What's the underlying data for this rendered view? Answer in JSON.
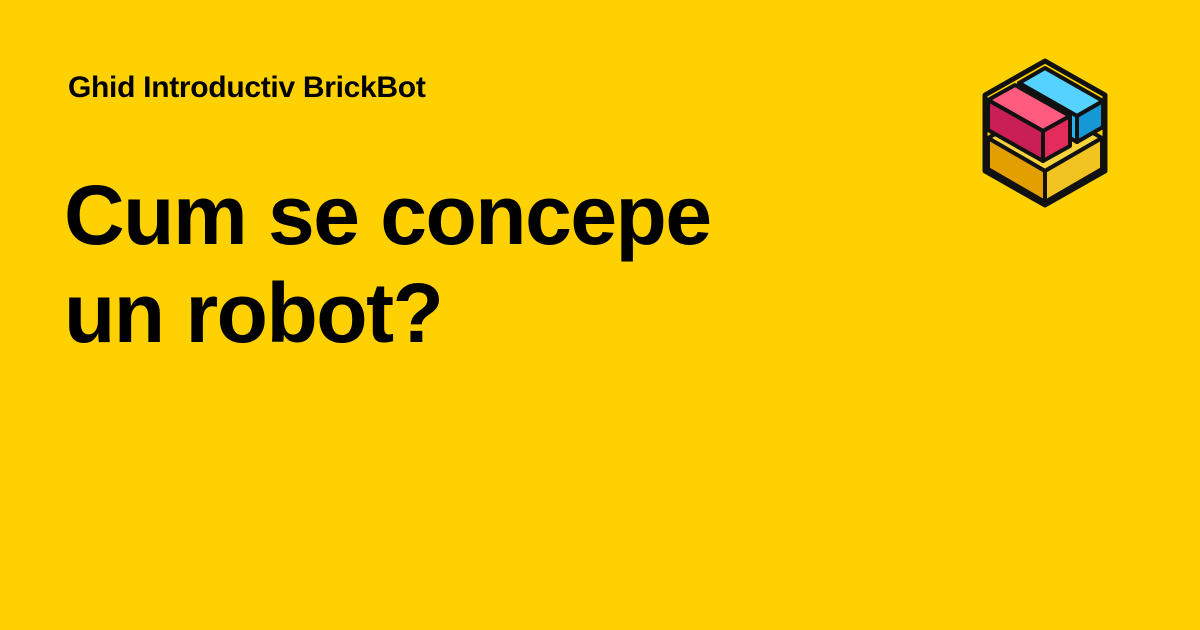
{
  "brand": {
    "eyebrow": "Ghid Introductiv BrickBot",
    "logo_icon": "brickbot-isometric-bricks-logo",
    "background_color": "#FFD100"
  },
  "hero": {
    "title_line_1": "Cum se concepe",
    "title_line_2": "un robot?"
  },
  "colors": {
    "brick_red": "#E32B5C",
    "brick_blue": "#1FB0E6",
    "brick_yellow": "#F2C421",
    "outline": "#111111"
  }
}
